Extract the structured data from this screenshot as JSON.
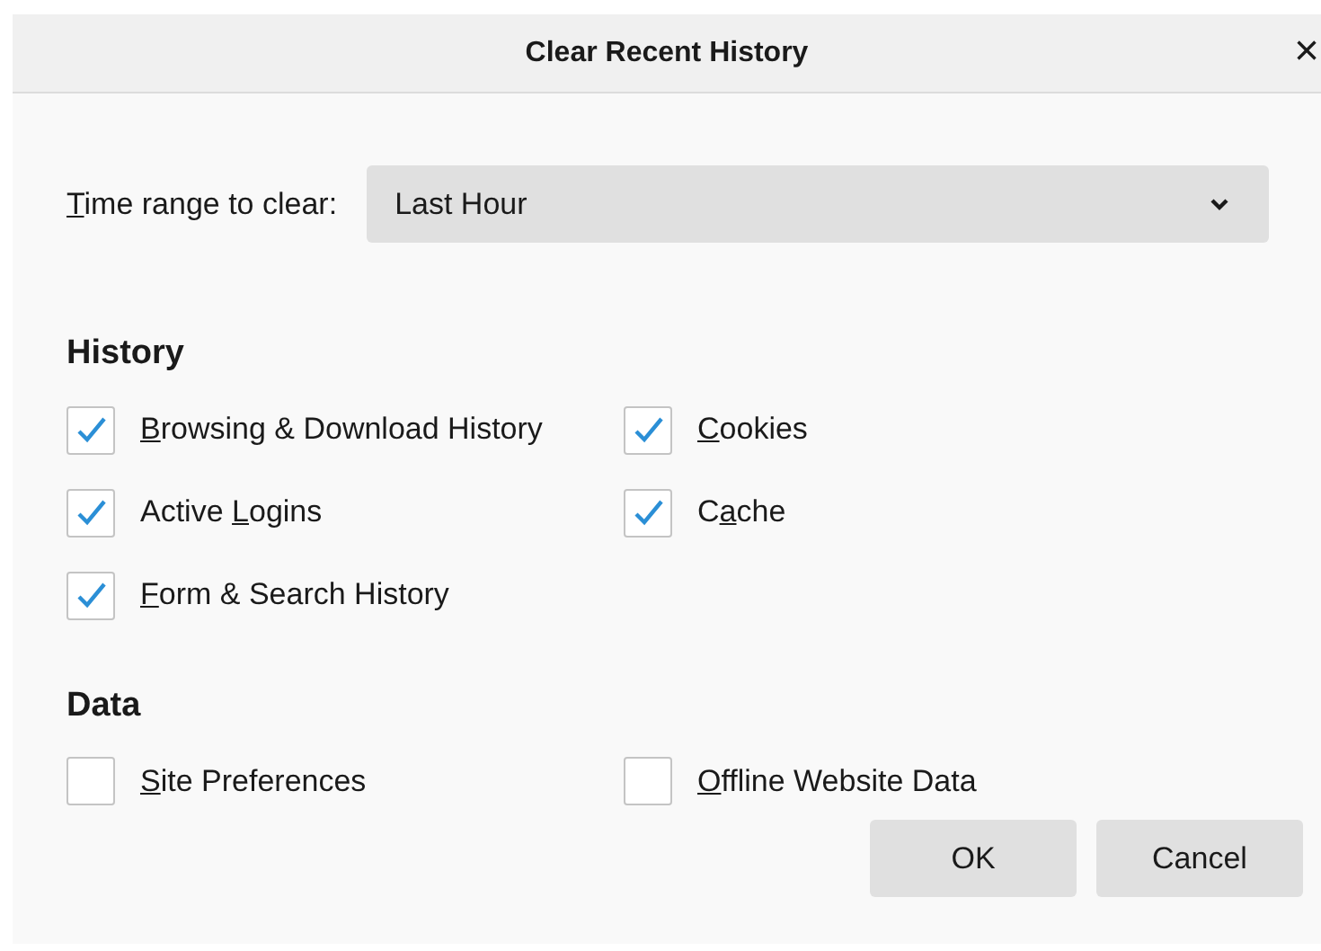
{
  "window": {
    "title": "Clear Recent History",
    "close": "×"
  },
  "time_range": {
    "label": {
      "key": "T",
      "post": "ime range to clear:"
    },
    "value": "Last Hour"
  },
  "sections": [
    {
      "title": "History",
      "items": [
        {
          "label": {
            "key": "B",
            "post": "rowsing & Download History"
          },
          "checked": true
        },
        {
          "label": {
            "key": "C",
            "post": "ookies"
          },
          "checked": true
        },
        {
          "label": {
            "pre": "Active ",
            "key": "L",
            "post": "ogins"
          },
          "checked": true
        },
        {
          "label": {
            "pre": "C",
            "key": "a",
            "post": "che"
          },
          "checked": true
        },
        {
          "label": {
            "key": "F",
            "post": "orm & Search History"
          },
          "checked": true
        }
      ]
    },
    {
      "title": "Data",
      "items": [
        {
          "label": {
            "key": "S",
            "post": "ite Preferences"
          },
          "checked": false
        },
        {
          "label": {
            "key": "O",
            "post": "ffline Website Data"
          },
          "checked": false
        }
      ]
    }
  ],
  "buttons": [
    "OK",
    "Cancel"
  ]
}
